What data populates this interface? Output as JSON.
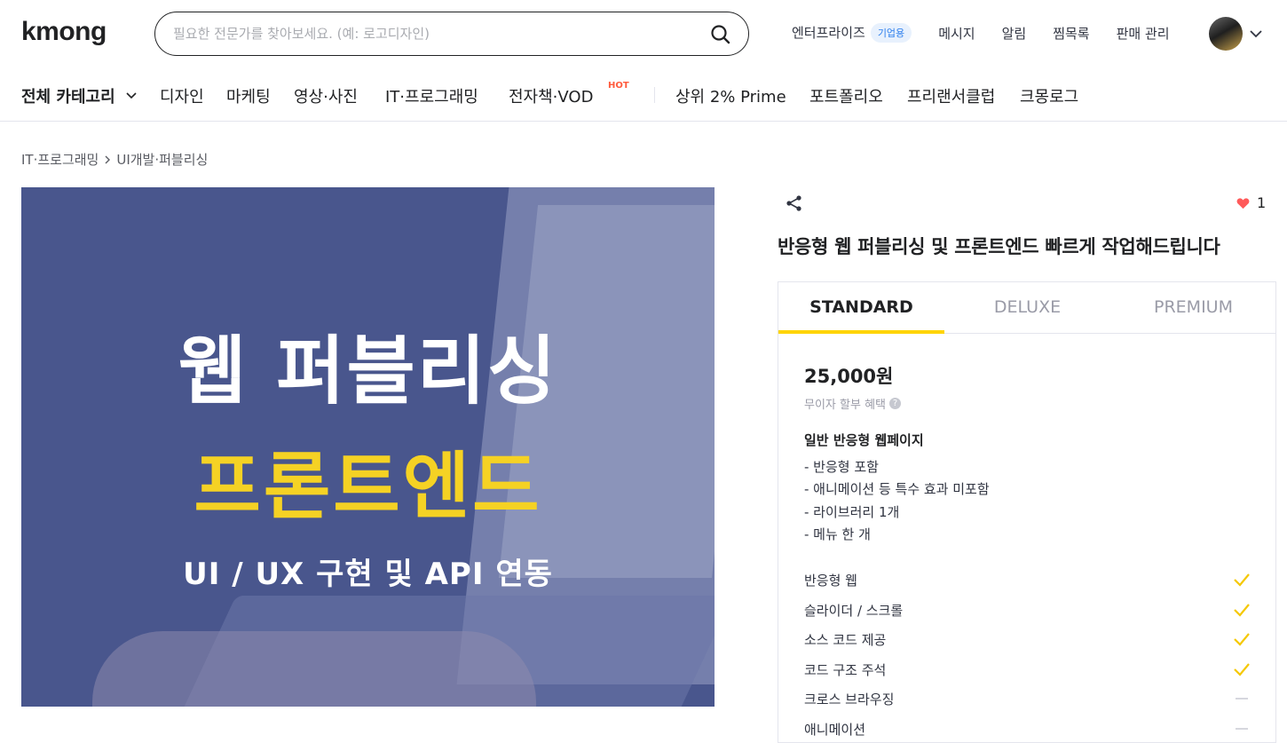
{
  "header": {
    "logo": "kmong",
    "search_placeholder": "필요한 전문가를 찾아보세요. (예: 로고디자인)",
    "nav": [
      {
        "label": "엔터프라이즈",
        "badge": "기업용"
      },
      {
        "label": "메시지"
      },
      {
        "label": "알림"
      },
      {
        "label": "찜목록"
      },
      {
        "label": "판매 관리"
      }
    ]
  },
  "categories": {
    "all": "전체 카테고리",
    "items": [
      "디자인",
      "마케팅",
      "영상·사진",
      "IT·프로그래밍",
      "전자책·VOD"
    ],
    "hot_label": "HOT",
    "extra": [
      "상위 2% Prime",
      "포트폴리오",
      "프리랜서클럽",
      "크몽로그"
    ]
  },
  "breadcrumb": [
    "IT·프로그래밍",
    "UI개발·퍼블리싱"
  ],
  "hero": {
    "line1": "웹 퍼블리싱",
    "line2": "프론트엔드",
    "line3": "UI / UX 구현 및 API 연동"
  },
  "gig": {
    "likes": "1",
    "title": "반응형 웹 퍼블리싱 및 프론트엔드 빠르게 작업해드립니다"
  },
  "package": {
    "tabs": [
      "STANDARD",
      "DELUXE",
      "PREMIUM"
    ],
    "active_tab": "STANDARD",
    "price": "25,000원",
    "installment": "무이자 할부 혜택",
    "name": "일반 반응형 웹페이지",
    "description": [
      "- 반응형 포함",
      "- 애니메이션 등 특수 효과 미포함",
      "- 라이브러리 1개",
      "- 메뉴 한 개"
    ],
    "features": [
      {
        "label": "반응형 웹",
        "included": true
      },
      {
        "label": "슬라이더 / 스크롤",
        "included": true
      },
      {
        "label": "소스 코드 제공",
        "included": true
      },
      {
        "label": "코드 구조 주석",
        "included": true
      },
      {
        "label": "크로스 브라우징",
        "included": false
      },
      {
        "label": "애니메이션",
        "included": false
      }
    ]
  },
  "colors": {
    "accent_yellow": "#ffd400",
    "heart": "#ff5a5a",
    "hot": "#ff5a3c",
    "badge_blue": "#2f80ed"
  }
}
